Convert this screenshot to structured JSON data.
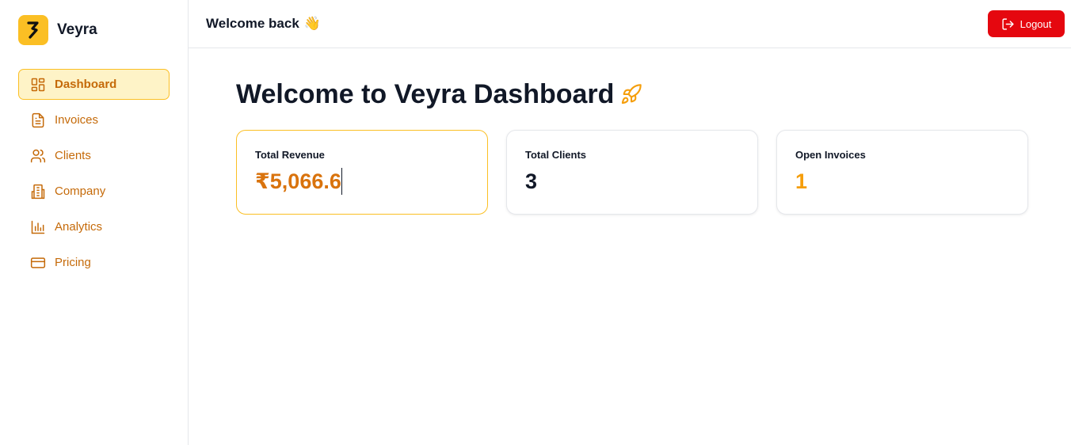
{
  "brand": {
    "name": "Veyra"
  },
  "sidebar": {
    "items": [
      {
        "label": "Dashboard",
        "icon": "layout-grid-icon",
        "active": true
      },
      {
        "label": "Invoices",
        "icon": "file-text-icon",
        "active": false
      },
      {
        "label": "Clients",
        "icon": "users-icon",
        "active": false
      },
      {
        "label": "Company",
        "icon": "building-icon",
        "active": false
      },
      {
        "label": "Analytics",
        "icon": "bar-chart-icon",
        "active": false
      },
      {
        "label": "Pricing",
        "icon": "credit-card-icon",
        "active": false
      }
    ]
  },
  "header": {
    "welcome": "Welcome back",
    "welcome_emoji": "👋",
    "logout_label": "Logout"
  },
  "main": {
    "title": "Welcome to Veyra Dashboard",
    "stats": [
      {
        "label": "Total Revenue",
        "value": "₹5,066.6"
      },
      {
        "label": "Total Clients",
        "value": "3"
      },
      {
        "label": "Open Invoices",
        "value": "1"
      }
    ]
  },
  "colors": {
    "accent": "#d9730d",
    "brand_yellow": "#fbbf24",
    "active_bg": "#fef3c7",
    "logout_red": "#e5070f",
    "open_invoices": "#f59e0b"
  }
}
